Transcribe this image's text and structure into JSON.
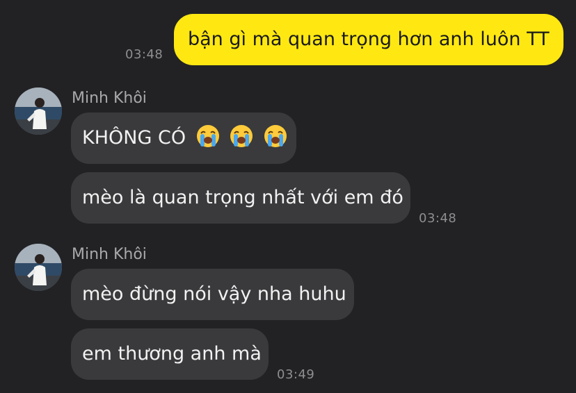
{
  "messages": [
    {
      "direction": "outgoing",
      "text": "bận gì mà quan trọng hơn anh luôn TT",
      "time": "03:48"
    },
    {
      "direction": "incoming",
      "sender": "Minh Khôi",
      "text": "KHÔNG CÓ",
      "emoji_icon": "loudly-crying-face-icon",
      "emoji_count": 3
    },
    {
      "direction": "incoming",
      "text": "mèo là quan trọng nhất với em đó",
      "time": "03:48"
    },
    {
      "direction": "incoming",
      "sender": "Minh Khôi",
      "text": "mèo đừng nói vậy nha huhu"
    },
    {
      "direction": "incoming",
      "text": "em thương anh mà",
      "time": "03:49"
    }
  ],
  "colors": {
    "background": "#222224",
    "outgoing_bubble": "#ffe812",
    "incoming_bubble": "#3a3a3c"
  }
}
